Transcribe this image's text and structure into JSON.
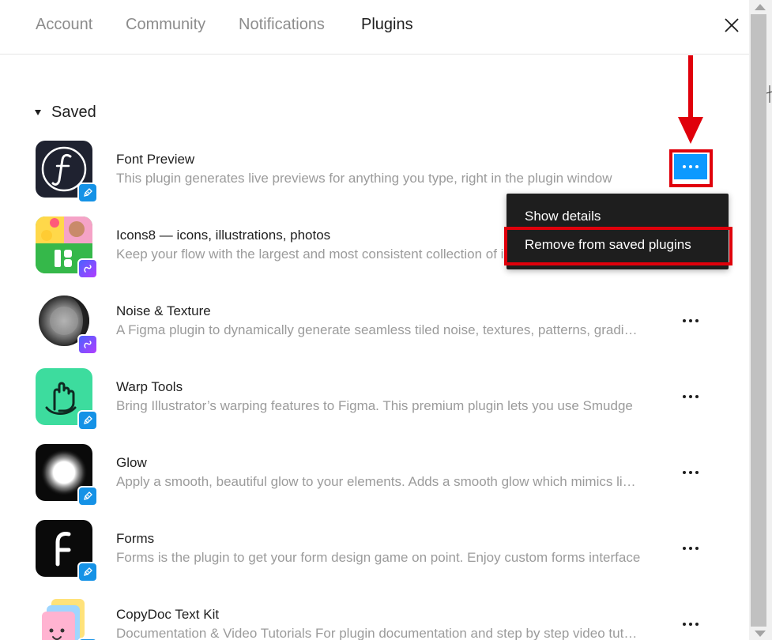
{
  "tabs": [
    {
      "label": "Account"
    },
    {
      "label": "Community"
    },
    {
      "label": "Notifications"
    },
    {
      "label": "Plugins",
      "active": true
    }
  ],
  "section": {
    "title": "Saved",
    "expanded": true
  },
  "plugins": [
    {
      "name": "Font Preview",
      "description": "This plugin generates live previews for anything you type, right in the plugin window",
      "icon": "font-f-icon",
      "badge": "blue"
    },
    {
      "name": "Icons8 — icons, illustrations, photos",
      "description": "Keep your flow with the largest and most consistent collection of icons, illustrations, photos",
      "icon": "icons8-icon",
      "badge": "purple"
    },
    {
      "name": "Noise & Texture",
      "description": "A Figma plugin to dynamically generate seamless tiled noise, textures, patterns, gradients",
      "icon": "noise-sphere-icon",
      "badge": "purple"
    },
    {
      "name": "Warp Tools",
      "description": "Bring Illustrator’s warping features to Figma. This premium plugin lets you use Smudge",
      "icon": "warp-hand-icon",
      "badge": "blue"
    },
    {
      "name": "Glow",
      "description": "Apply a smooth, beautiful glow to your elements. Adds a smooth glow which mimics light",
      "icon": "glow-icon",
      "badge": "blue"
    },
    {
      "name": "Forms",
      "description": "Forms is the plugin to get your form design game on point. Enjoy custom forms interface",
      "icon": "forms-f-icon",
      "badge": "blue"
    },
    {
      "name": "CopyDoc Text Kit",
      "description": "Documentation & Video Tutorials For plugin documentation and step by step video tutorials",
      "icon": "copydoc-icon",
      "badge": "blue"
    }
  ],
  "context_menu": {
    "items": [
      {
        "label": "Show details"
      },
      {
        "label": "Remove from saved plugins",
        "highlighted": true
      }
    ]
  },
  "colors": {
    "accent": "#0d99ff",
    "annotation": "#e0000b",
    "menu_bg": "#1e1e1e",
    "badge_blue": "#1592e6"
  }
}
